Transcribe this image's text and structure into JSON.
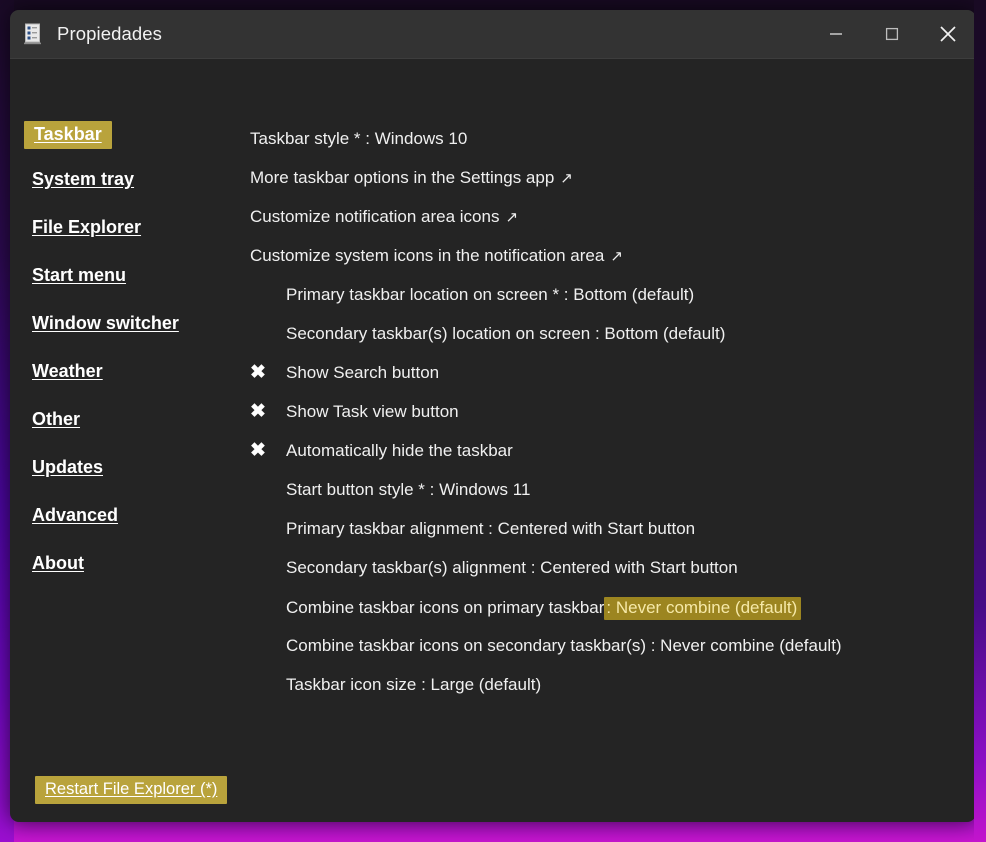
{
  "window": {
    "title": "Propiedades",
    "icon": "properties-document-icon",
    "controls": {
      "minimize": "minimize-icon",
      "maximize": "maximize-icon",
      "close": "close-icon"
    }
  },
  "colors": {
    "window_bg": "#242424",
    "titlebar_bg": "#333333",
    "accent_gold": "#b9a33c",
    "highlight_bg": "#9c8520",
    "highlight_text": "#f6e9a8",
    "text": "#f0f0f0",
    "border_purple": "#6f08c0",
    "border_magenta": "#c715cf"
  },
  "sidebar": {
    "items": [
      {
        "label": "Taskbar",
        "selected": true
      },
      {
        "label": "System tray",
        "selected": false
      },
      {
        "label": "File Explorer",
        "selected": false
      },
      {
        "label": "Start menu",
        "selected": false
      },
      {
        "label": "Window switcher",
        "selected": false
      },
      {
        "label": "Weather",
        "selected": false
      },
      {
        "label": "Other",
        "selected": false
      },
      {
        "label": "Updates",
        "selected": false
      },
      {
        "label": "Advanced",
        "selected": false
      },
      {
        "label": "About",
        "selected": false
      }
    ]
  },
  "footer": {
    "restart_label": "Restart File Explorer (*)"
  },
  "main": {
    "rows": [
      {
        "kind": "link",
        "label": "Taskbar style * : Windows 10",
        "arrow": ""
      },
      {
        "kind": "link",
        "label": "More taskbar options in the Settings app",
        "arrow": "↗"
      },
      {
        "kind": "link",
        "label": "Customize notification area icons",
        "arrow": "↗"
      },
      {
        "kind": "link",
        "label": "Customize system icons in the notification area",
        "arrow": "↗"
      },
      {
        "kind": "setting",
        "label": "Primary taskbar location on screen * : Bottom (default)",
        "arrow": ""
      },
      {
        "kind": "setting",
        "label": "Secondary taskbar(s) location on screen : Bottom (default)",
        "arrow": ""
      },
      {
        "kind": "check",
        "label": "Show Search button",
        "mark": "✖",
        "checked": false
      },
      {
        "kind": "check",
        "label": "Show Task view button",
        "mark": "✖",
        "checked": false
      },
      {
        "kind": "check",
        "label": "Automatically hide the taskbar",
        "mark": "✖",
        "checked": false
      },
      {
        "kind": "setting",
        "label": "Start button style * : Windows 11",
        "arrow": ""
      },
      {
        "kind": "setting",
        "label": "Primary taskbar alignment : Centered with Start button",
        "arrow": ""
      },
      {
        "kind": "setting",
        "label": "Secondary taskbar(s) alignment : Centered with Start button",
        "arrow": ""
      },
      {
        "kind": "split",
        "label": "Combine taskbar icons on primary taskbar",
        "highlight": " : Never combine (default)"
      },
      {
        "kind": "setting",
        "label": "Combine taskbar icons on secondary taskbar(s) : Never combine (default)",
        "arrow": ""
      },
      {
        "kind": "setting",
        "label": "Taskbar icon size : Large (default)",
        "arrow": ""
      }
    ]
  }
}
